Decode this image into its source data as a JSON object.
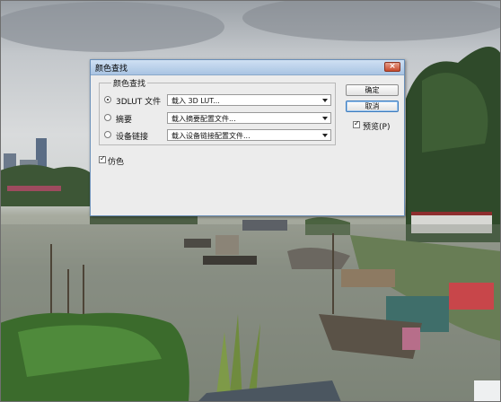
{
  "dialog": {
    "title": "颜色查找",
    "close_glyph": "×",
    "group_label": "颜色查找",
    "options": [
      {
        "label": "3DLUT 文件",
        "selected": true,
        "dropdown_value": "载入 3D LUT..."
      },
      {
        "label": "摘要",
        "selected": false,
        "dropdown_value": "载入摘要配置文件..."
      },
      {
        "label": "设备链接",
        "selected": false,
        "dropdown_value": "载入设备链接配置文件..."
      }
    ],
    "ok_label": "确定",
    "cancel_label": "取消",
    "preview_label": "预览(P)",
    "preview_checked": true,
    "dither_label": "仿色",
    "dither_checked": true
  },
  "colors": {
    "titlebar": "#a9c4e3",
    "dialog_bg": "#ececec",
    "close_button": "#c74a2c"
  }
}
